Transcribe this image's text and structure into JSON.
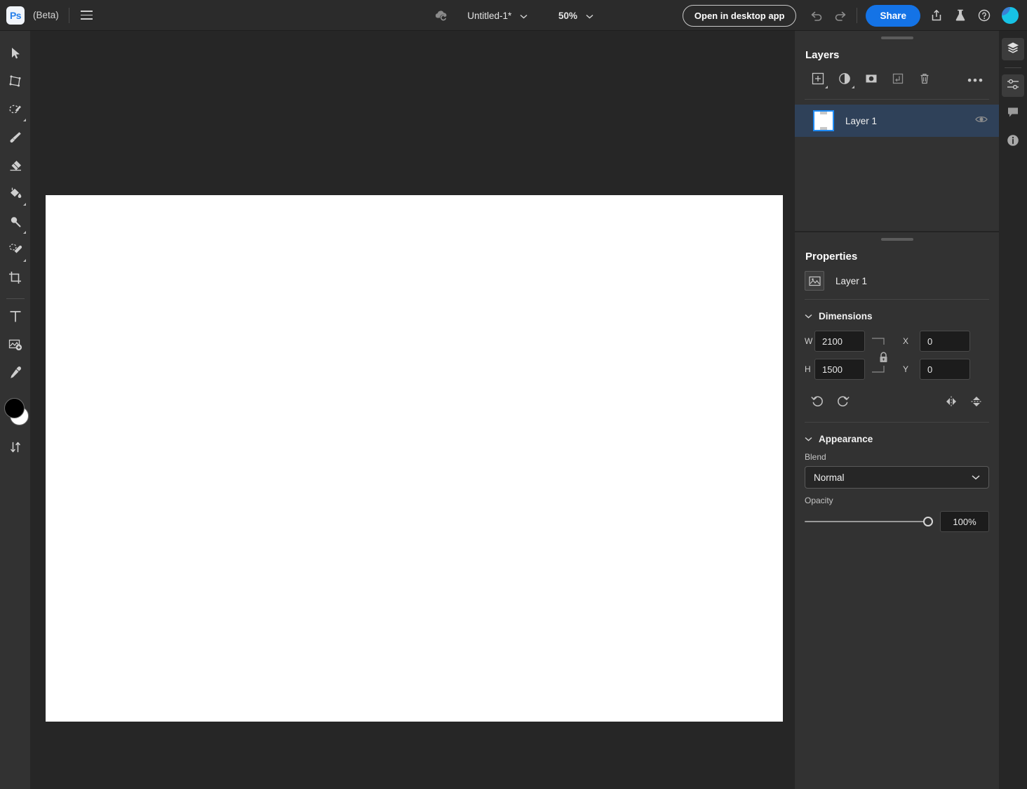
{
  "app": {
    "logo_text": "Ps",
    "beta_label": "(Beta)",
    "brand_blue": "#1473e6",
    "accent_blue": "#1f8bf5",
    "avatar_color": "#17c3e6"
  },
  "topbar": {
    "document_title": "Untitled-1*",
    "zoom_level": "50%",
    "open_desktop_label": "Open in desktop app",
    "share_label": "Share",
    "icons": {
      "menu": "hamburger-icon",
      "cloud": "cloud-sync-icon",
      "title_chevron": "chevron-down-icon",
      "zoom_chevron": "chevron-down-icon",
      "undo": "undo-icon",
      "redo": "redo-icon",
      "export": "export-share-icon",
      "labs": "beaker-icon",
      "help": "help-circle-icon",
      "avatar": "user-avatar"
    }
  },
  "toolbar": {
    "tools": [
      {
        "name": "move-tool",
        "icon": "cursor-arrow-icon",
        "has_flyout": false
      },
      {
        "name": "transform-tool",
        "icon": "transform-quad-icon",
        "has_flyout": false
      },
      {
        "name": "lasso-select-tool",
        "icon": "lasso-select-icon",
        "has_flyout": true
      },
      {
        "name": "brush-tool",
        "icon": "paintbrush-icon",
        "has_flyout": false
      },
      {
        "name": "eraser-tool",
        "icon": "eraser-icon",
        "has_flyout": false
      },
      {
        "name": "paint-bucket-tool",
        "icon": "paint-bucket-icon",
        "has_flyout": true
      },
      {
        "name": "dodge-tool",
        "icon": "dodge-icon",
        "has_flyout": true
      },
      {
        "name": "healing-brush-tool",
        "icon": "healing-brush-icon",
        "has_flyout": true
      },
      {
        "name": "crop-tool",
        "icon": "crop-icon",
        "has_flyout": false
      },
      {
        "name": "type-tool",
        "icon": "type-t-icon",
        "has_flyout": false
      },
      {
        "name": "place-image-tool",
        "icon": "add-image-icon",
        "has_flyout": false
      },
      {
        "name": "eyedropper-tool",
        "icon": "eyedropper-icon",
        "has_flyout": false
      }
    ],
    "foreground_color": "#000000",
    "background_color": "#ffffff",
    "swap_icon": "swap-arrows-icon"
  },
  "canvas": {
    "background_color": "#262626",
    "document_color": "#ffffff"
  },
  "layers_panel": {
    "title": "Layers",
    "tools": [
      {
        "name": "add-layer-button",
        "icon": "add-layer-icon",
        "has_flyout": true
      },
      {
        "name": "adjustment-layer-button",
        "icon": "adjustment-circle-icon",
        "has_flyout": true
      },
      {
        "name": "layer-mask-button",
        "icon": "layer-mask-icon",
        "has_flyout": false
      },
      {
        "name": "clipping-mask-button",
        "icon": "clipping-mask-arrow-icon",
        "has_flyout": false
      },
      {
        "name": "delete-layer-button",
        "icon": "trash-icon",
        "has_flyout": false
      }
    ],
    "more_label": "•••",
    "layers": [
      {
        "name": "Layer 1",
        "visible": true,
        "selected": true,
        "visibility_icon": "eye-icon"
      }
    ]
  },
  "properties_panel": {
    "title": "Properties",
    "layer_name": "Layer 1",
    "layer_thumb_icon": "image-thumbnail-icon",
    "dimensions": {
      "section_label": "Dimensions",
      "collapse_icon": "chevron-down-icon",
      "w_label": "W",
      "w_value": "2100",
      "h_label": "H",
      "h_value": "1500",
      "x_label": "X",
      "x_value": "0",
      "y_label": "Y",
      "y_value": "0",
      "lock_icon": "lock-aspect-ratio-icon",
      "transform_buttons": [
        {
          "name": "rotate-counterclockwise-button",
          "icon": "rotate-ccw-icon"
        },
        {
          "name": "rotate-clockwise-button",
          "icon": "rotate-cw-icon"
        },
        {
          "name": "flip-horizontal-button",
          "icon": "flip-horizontal-icon"
        },
        {
          "name": "flip-vertical-button",
          "icon": "flip-vertical-icon"
        }
      ]
    },
    "appearance": {
      "section_label": "Appearance",
      "collapse_icon": "chevron-down-icon",
      "blend_label": "Blend",
      "blend_value": "Normal",
      "blend_chevron": "chevron-down-icon",
      "opacity_label": "Opacity",
      "opacity_value": "100%",
      "opacity_percent": 100
    }
  },
  "right_rail": {
    "items": [
      {
        "name": "rail-layers-tab",
        "icon": "layers-stack-icon",
        "active": true
      },
      {
        "name": "rail-properties-tab",
        "icon": "sliders-icon",
        "active": true
      },
      {
        "name": "rail-comments-tab",
        "icon": "comment-bubble-icon",
        "active": false
      },
      {
        "name": "rail-info-tab",
        "icon": "info-circle-icon",
        "active": false
      }
    ]
  }
}
